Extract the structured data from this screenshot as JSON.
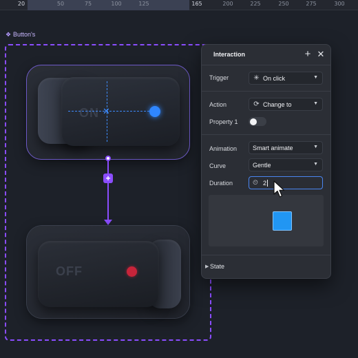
{
  "ruler": {
    "ticks": [
      "20",
      "50",
      "75",
      "100",
      "125",
      "165",
      "200",
      "225",
      "250",
      "275",
      "300"
    ]
  },
  "canvas": {
    "frame_label": "Button's",
    "on_label": "ON",
    "off_label": "OFF",
    "led_on_color": "#2f86ff",
    "led_off_color": "#c7243a",
    "accent_color": "#8b4dff"
  },
  "panel": {
    "title": "Interaction",
    "trigger": {
      "label": "Trigger",
      "value": "On click",
      "icon": "tap-icon"
    },
    "action": {
      "label": "Action",
      "value": "Change to",
      "icon": "swap-icon"
    },
    "property": {
      "label": "Property 1",
      "on": false
    },
    "animation": {
      "label": "Animation",
      "value": "Smart animate"
    },
    "curve": {
      "label": "Curve",
      "value": "Gentle"
    },
    "duration": {
      "label": "Duration",
      "value": "2",
      "icon": "timer-icon"
    },
    "preview_color": "#2196f3",
    "state": {
      "label": "State"
    }
  }
}
